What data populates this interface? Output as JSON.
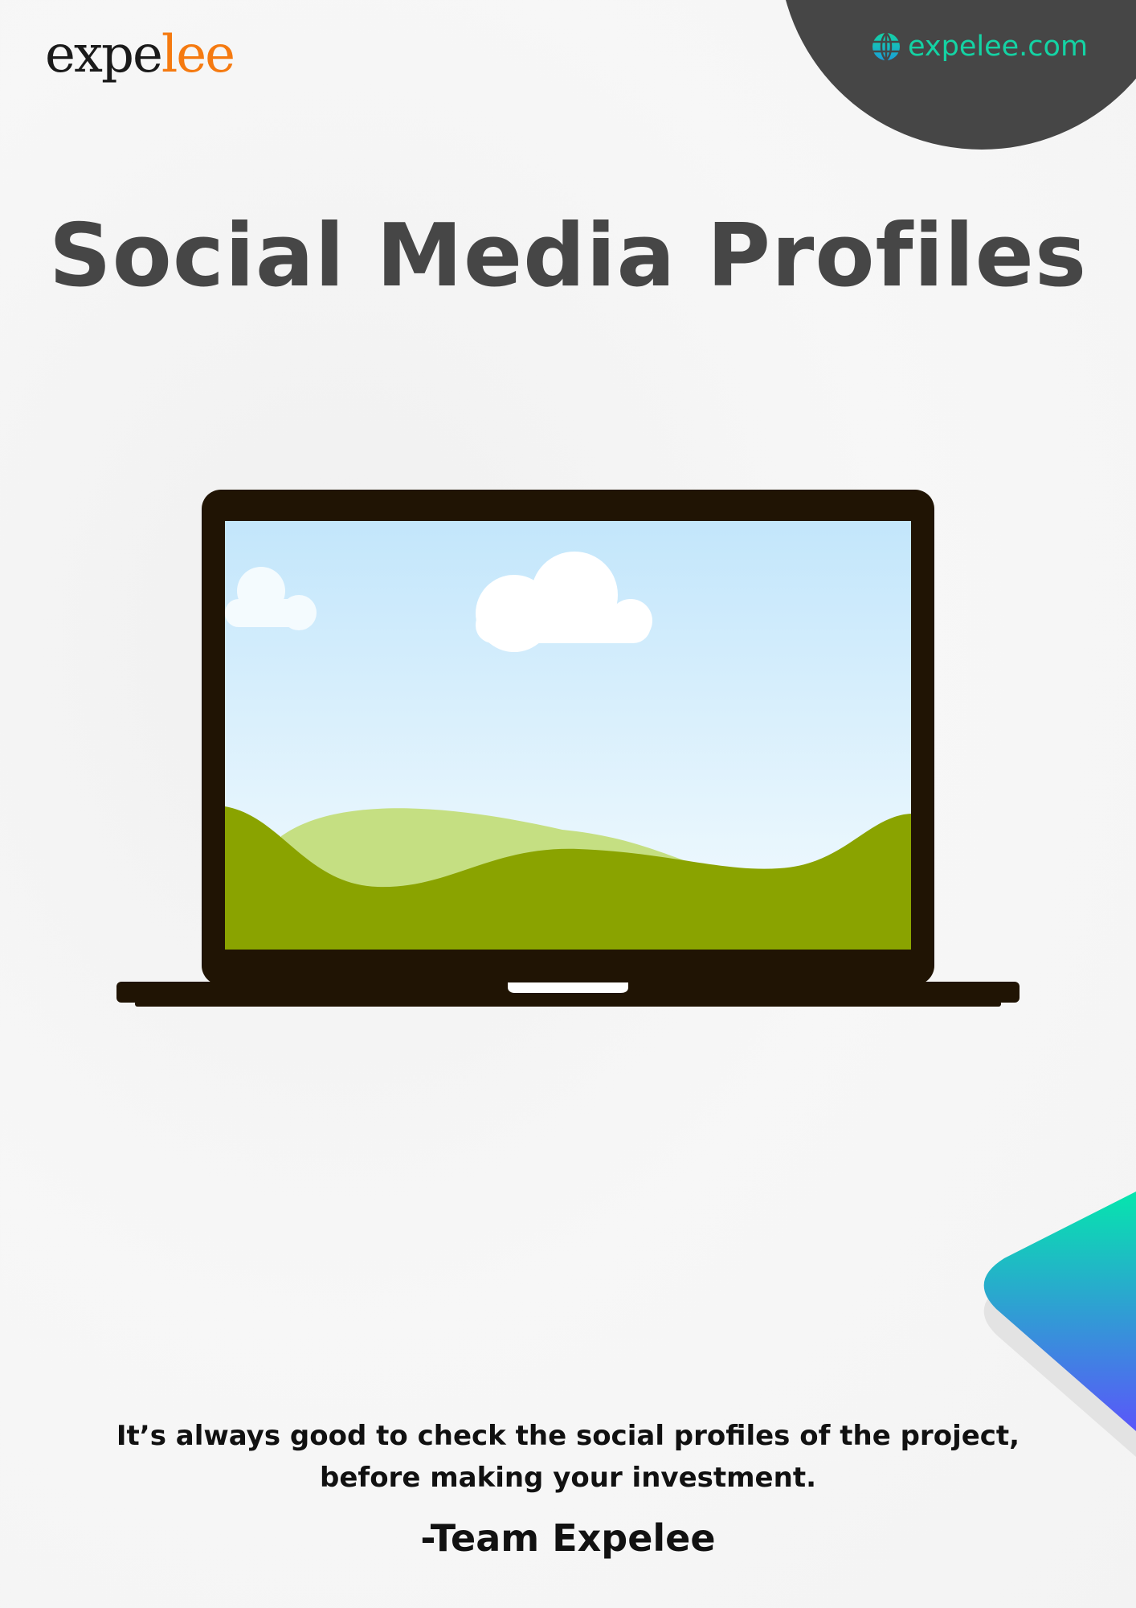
{
  "brand": {
    "logo_part1": "expe",
    "logo_part2": "lee",
    "website": "expelee.com"
  },
  "title": "Social Media Profiles",
  "quote": {
    "line1": "It’s always good to check the social profiles of the project,",
    "line2": "before making your investment."
  },
  "signature": "-Team Expelee",
  "colors": {
    "accent": "#f57a10",
    "teal": "#14d3a4",
    "dark": "#464646"
  }
}
